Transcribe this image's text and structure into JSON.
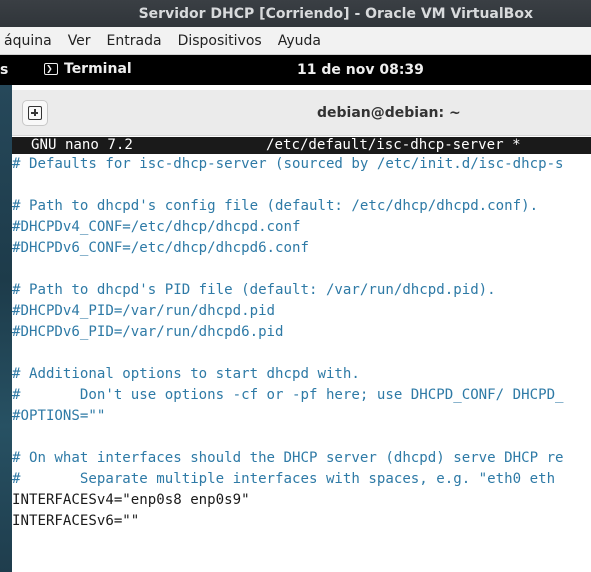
{
  "vbox_window": {
    "title": "Servidor DHCP [Corriendo] - Oracle VM VirtualBox"
  },
  "vbox_menu": {
    "items": [
      "áquina",
      "Ver",
      "Entrada",
      "Dispositivos",
      "Ayuda"
    ]
  },
  "gnome_bar": {
    "activities": "s",
    "app_name": "Terminal",
    "clock": "11 de nov  08:39"
  },
  "terminal": {
    "title": "debian@debian: ~",
    "nano_version": "GNU nano 7.2",
    "file_path": "/etc/default/isc-dhcp-server *",
    "lines": [
      {
        "text": "# Defaults for isc-dhcp-server (sourced by /etc/init.d/isc-dhcp-s",
        "kind": "comment"
      },
      {
        "text": "",
        "kind": "blank"
      },
      {
        "text": "# Path to dhcpd's config file (default: /etc/dhcp/dhcpd.conf).",
        "kind": "comment"
      },
      {
        "text": "#DHCPDv4_CONF=/etc/dhcp/dhcpd.conf",
        "kind": "comment"
      },
      {
        "text": "#DHCPDv6_CONF=/etc/dhcp/dhcpd6.conf",
        "kind": "comment"
      },
      {
        "text": "",
        "kind": "blank"
      },
      {
        "text": "# Path to dhcpd's PID file (default: /var/run/dhcpd.pid).",
        "kind": "comment"
      },
      {
        "text": "#DHCPDv4_PID=/var/run/dhcpd.pid",
        "kind": "comment"
      },
      {
        "text": "#DHCPDv6_PID=/var/run/dhcpd6.pid",
        "kind": "comment"
      },
      {
        "text": "",
        "kind": "blank"
      },
      {
        "text": "# Additional options to start dhcpd with.",
        "kind": "comment"
      },
      {
        "text": "#       Don't use options -cf or -pf here; use DHCPD_CONF/ DHCPD_",
        "kind": "comment"
      },
      {
        "text": "#OPTIONS=\"\"",
        "kind": "comment"
      },
      {
        "text": "",
        "kind": "blank"
      },
      {
        "text": "# On what interfaces should the DHCP server (dhcpd) serve DHCP re",
        "kind": "comment"
      },
      {
        "text": "#       Separate multiple interfaces with spaces, e.g. \"eth0 eth",
        "kind": "comment"
      },
      {
        "text": "INTERFACESv4=\"enp0s8 enp0s9\"",
        "kind": "plain"
      },
      {
        "text": "INTERFACESv6=\"\"",
        "kind": "plain"
      }
    ]
  },
  "colors": {
    "comment": "#2e7aa6",
    "text": "#1a1a1a",
    "nano_bar_bg": "#1a1a1a",
    "terminal_bg": "#ffffff",
    "topbar_bg": "#000000"
  }
}
